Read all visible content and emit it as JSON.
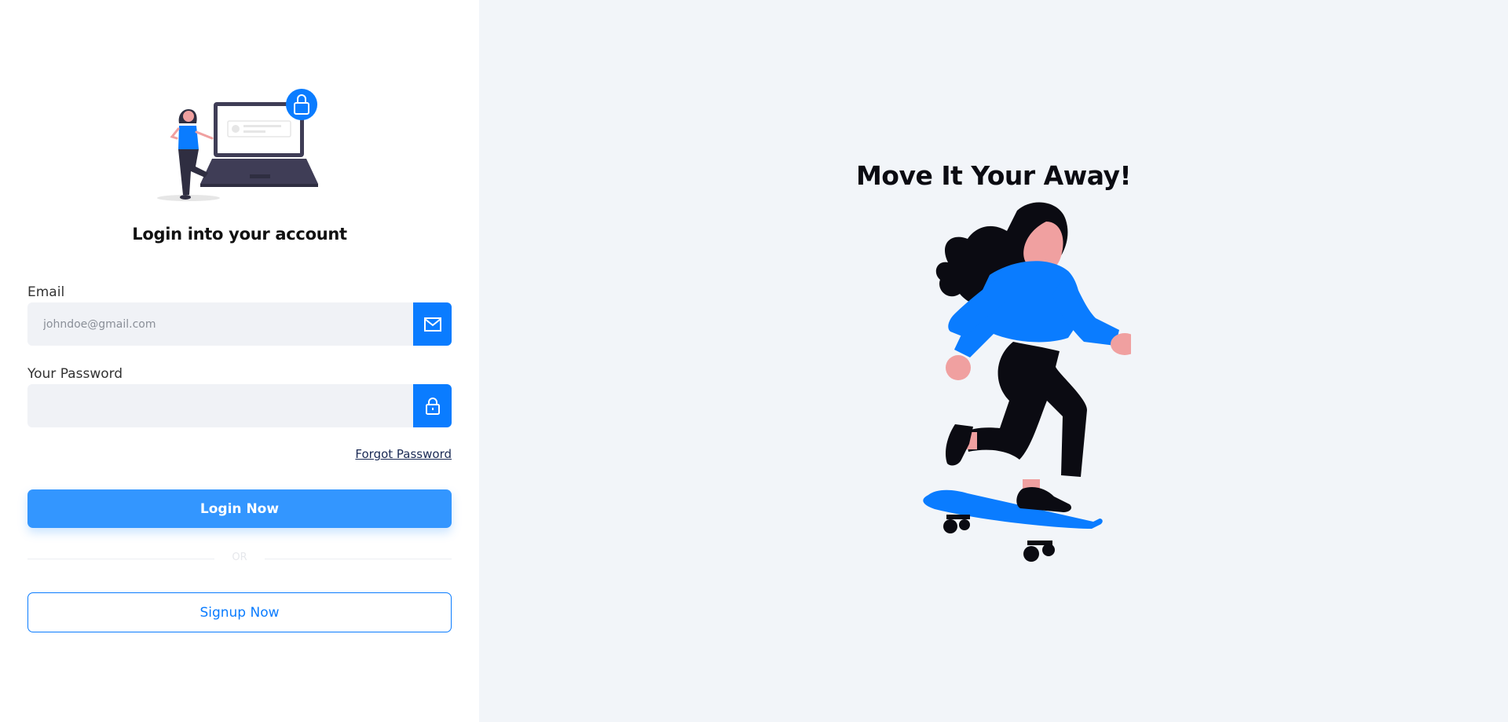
{
  "login": {
    "title": "Login into your account",
    "email_label": "Email",
    "email_placeholder": "johndoe@gmail.com",
    "email_value": "",
    "email_icon": "envelope-icon",
    "password_label": "Your Password",
    "password_placeholder": "",
    "password_value": "",
    "password_icon": "lock-icon",
    "forgot_link": "Forgot Password",
    "login_button": "Login Now",
    "divider_text": "OR",
    "signup_button": "Signup Now"
  },
  "hero": {
    "title": "Move It Your Away!"
  },
  "colors": {
    "primary": "#0a7cff",
    "primary_light": "#3396ff",
    "panel_bg": "#f2f5f9",
    "input_bg": "#f0f2f6",
    "skin": "#f0a0a0",
    "dark": "#0b0b12"
  }
}
